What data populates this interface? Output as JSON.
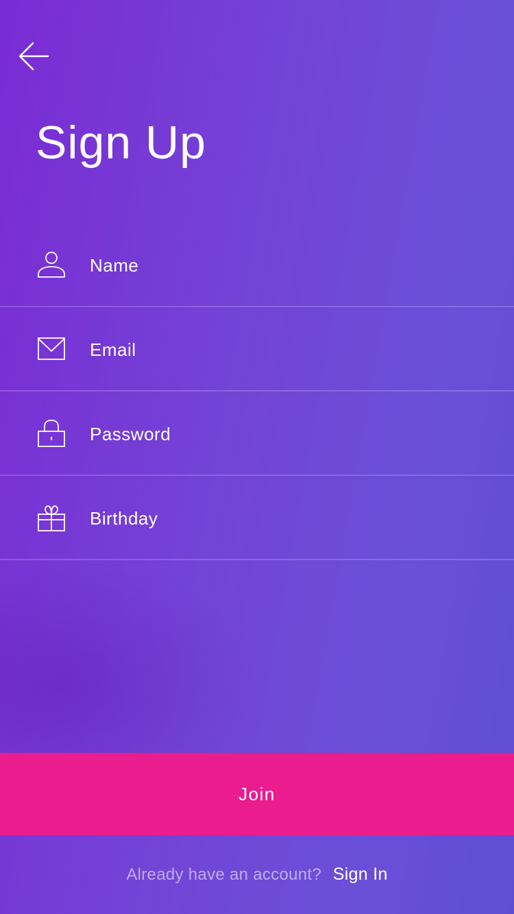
{
  "header": {
    "back_icon": "arrow-left-icon",
    "title": "Sign Up"
  },
  "form": {
    "fields": [
      {
        "icon": "user-icon",
        "label": "Name"
      },
      {
        "icon": "envelope-icon",
        "label": "Email"
      },
      {
        "icon": "lock-icon",
        "label": "Password"
      },
      {
        "icon": "gift-icon",
        "label": "Birthday"
      }
    ]
  },
  "actions": {
    "join_label": "Join",
    "signin_prompt": "Already have an account?",
    "signin_link": "Sign In"
  },
  "colors": {
    "background_start": "#7a2bd4",
    "background_end": "#5f4ed4",
    "accent": "#ea1c8e",
    "text": "#ffffff"
  }
}
